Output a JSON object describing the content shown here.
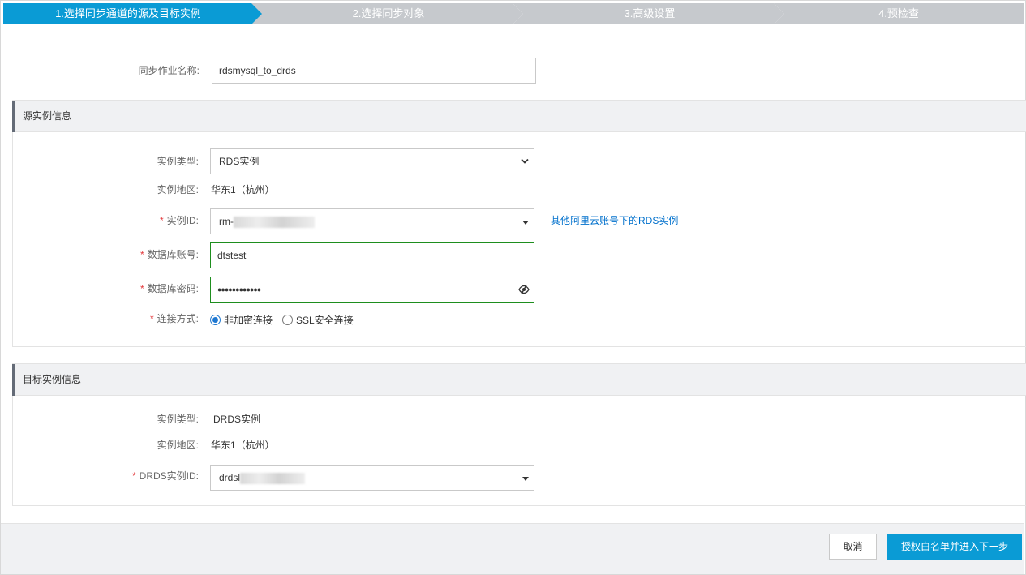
{
  "steps": [
    {
      "label": "1.选择同步通道的源及目标实例",
      "active": true
    },
    {
      "label": "2.选择同步对象",
      "active": false
    },
    {
      "label": "3.高级设置",
      "active": false
    },
    {
      "label": "4.预检查",
      "active": false
    }
  ],
  "job": {
    "name_label": "同步作业名称:",
    "name_value": "rdsmysql_to_drds"
  },
  "source": {
    "title": "源实例信息",
    "type_label": "实例类型:",
    "type_value": "RDS实例",
    "region_label": "实例地区:",
    "region_value": "华东1（杭州）",
    "id_label": "实例ID:",
    "id_prefix": "rm-",
    "other_account_link": "其他阿里云账号下的RDS实例",
    "account_label": "数据库账号:",
    "account_value": "dtstest",
    "password_label": "数据库密码:",
    "password_mask": "●●●●●●●●●●●●",
    "conn_label": "连接方式:",
    "conn_options": [
      "非加密连接",
      "SSL安全连接"
    ],
    "conn_selected": "非加密连接",
    "required_mark": "*"
  },
  "target": {
    "title": "目标实例信息",
    "type_label": "实例类型:",
    "type_value": "DRDS实例",
    "region_label": "实例地区:",
    "region_value": "华东1（杭州）",
    "id_label": "DRDS实例ID:",
    "id_prefix": "drdsl",
    "required_mark": "*"
  },
  "footer": {
    "cancel_label": "取消",
    "next_label": "授权白名单并进入下一步"
  },
  "colors": {
    "step_active": "#0a9bd5",
    "step_inactive": "#c6c9cd",
    "primary": "#0a9bd5",
    "link": "#0070cc",
    "valid_border": "#1e8e1e",
    "required": "#e3393c"
  },
  "icons": {
    "password_toggle": "eye-slash-icon",
    "dropdown": "caret-down-icon"
  }
}
